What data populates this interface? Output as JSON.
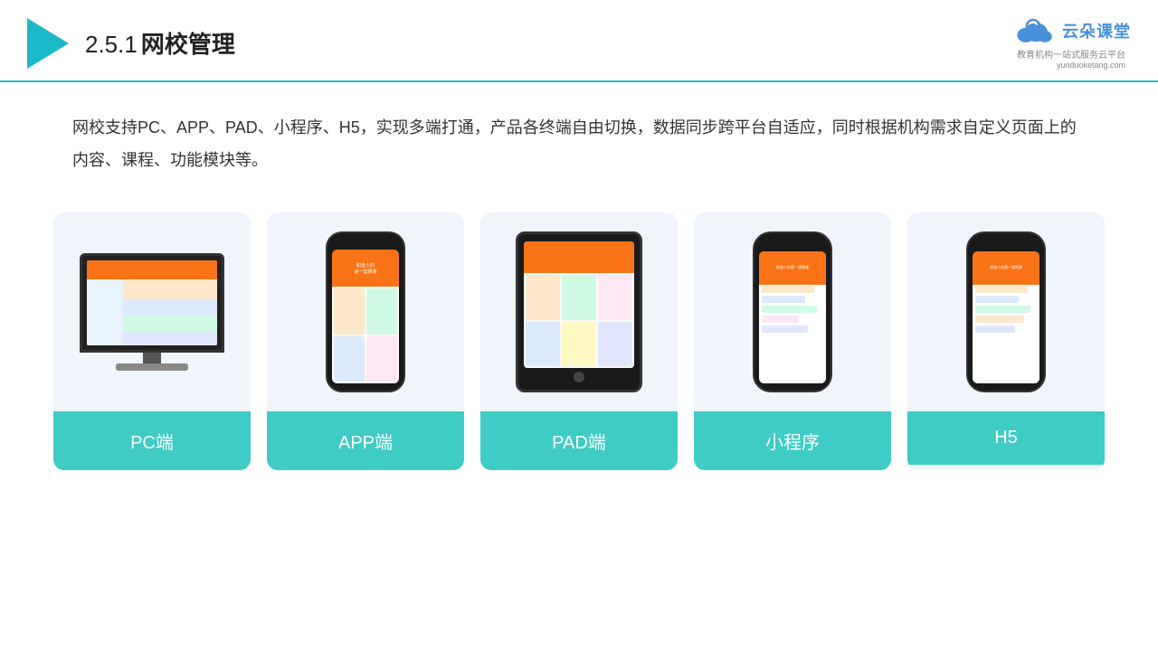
{
  "header": {
    "title": "网校管理",
    "title_number": "2.5.1",
    "brand_name": "云朵课堂",
    "brand_url": "yunduoketang.com",
    "brand_tagline": "教育机构一站式服务云平台"
  },
  "description": {
    "text": "网校支持PC、APP、PAD、小程序、H5，实现多端打通，产品各终端自由切换，数据同步跨平台自适应，同时根据机构需求自定义页面上的内容、课程、功能模块等。"
  },
  "cards": [
    {
      "label": "PC端",
      "type": "pc"
    },
    {
      "label": "APP端",
      "type": "phone"
    },
    {
      "label": "PAD端",
      "type": "tablet"
    },
    {
      "label": "小程序",
      "type": "phone2"
    },
    {
      "label": "H5",
      "type": "phone3"
    }
  ]
}
